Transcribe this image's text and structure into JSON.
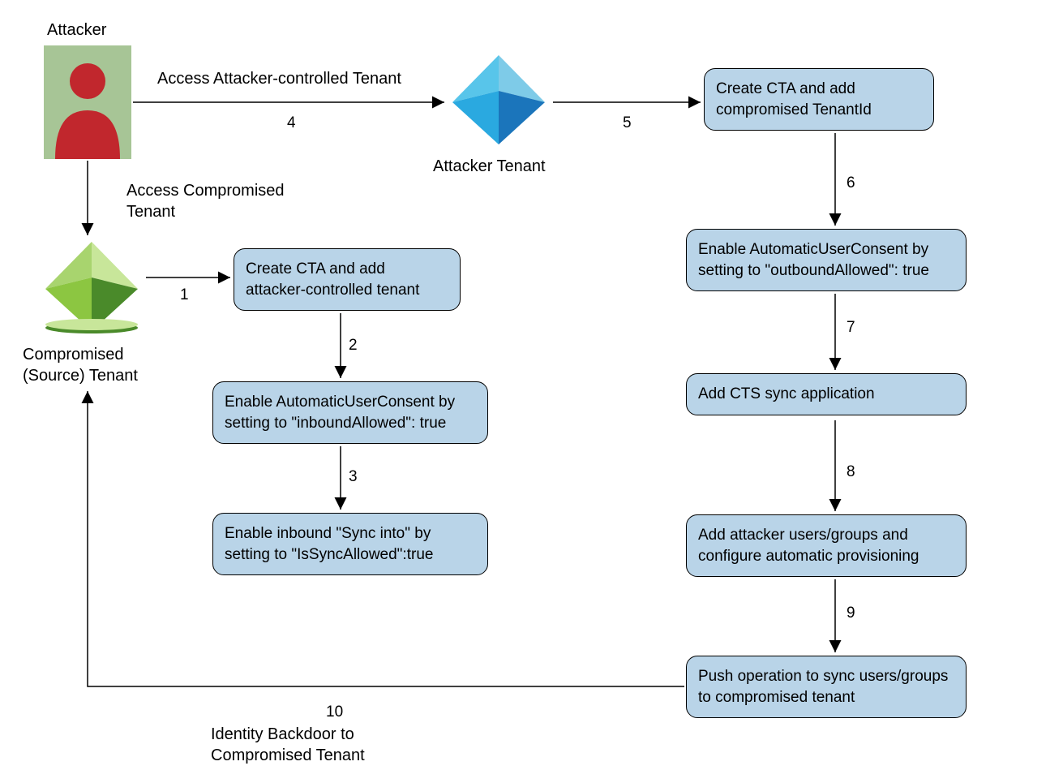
{
  "labels": {
    "attacker": "Attacker",
    "accessAttackerTenant": "Access Attacker-controlled Tenant",
    "attackerTenant": "Attacker Tenant",
    "accessCompromised": "Access Compromised\nTenant",
    "compromisedTenant": "Compromised\n(Source) Tenant",
    "identityBackdoor": "Identity Backdoor to\nCompromised Tenant"
  },
  "edges": {
    "e1": "1",
    "e2": "2",
    "e3": "3",
    "e4": "4",
    "e5": "5",
    "e6": "6",
    "e7": "7",
    "e8": "8",
    "e9": "9",
    "e10": "10"
  },
  "nodes": {
    "n1": "Create CTA and add attacker-controlled tenant",
    "n2": "Enable AutomaticUserConsent by setting to \"inboundAllowed\": true",
    "n3": "Enable inbound \"Sync into\" by setting to \"IsSyncAllowed\":true",
    "n5": "Create CTA and add compromised TenantId",
    "n6": "Enable AutomaticUserConsent by setting to \"outboundAllowed\": true",
    "n7": "Add CTS sync application",
    "n8": "Add attacker users/groups and configure automatic provisioning",
    "n9": "Push operation to sync users/groups to compromised tenant"
  },
  "colors": {
    "nodeFill": "#b9d4e8",
    "nodeStroke": "#000000",
    "attackerRed": "#c1272d",
    "attackerBg": "#a7c596",
    "blue1": "#2aa9e0",
    "blue2": "#1b75bb",
    "blue3": "#7ecbe8",
    "blue4": "#58c5ea",
    "green1": "#8cc641",
    "green2": "#4a8a2a",
    "green3": "#c8e69a",
    "green4": "#a8d46e"
  }
}
